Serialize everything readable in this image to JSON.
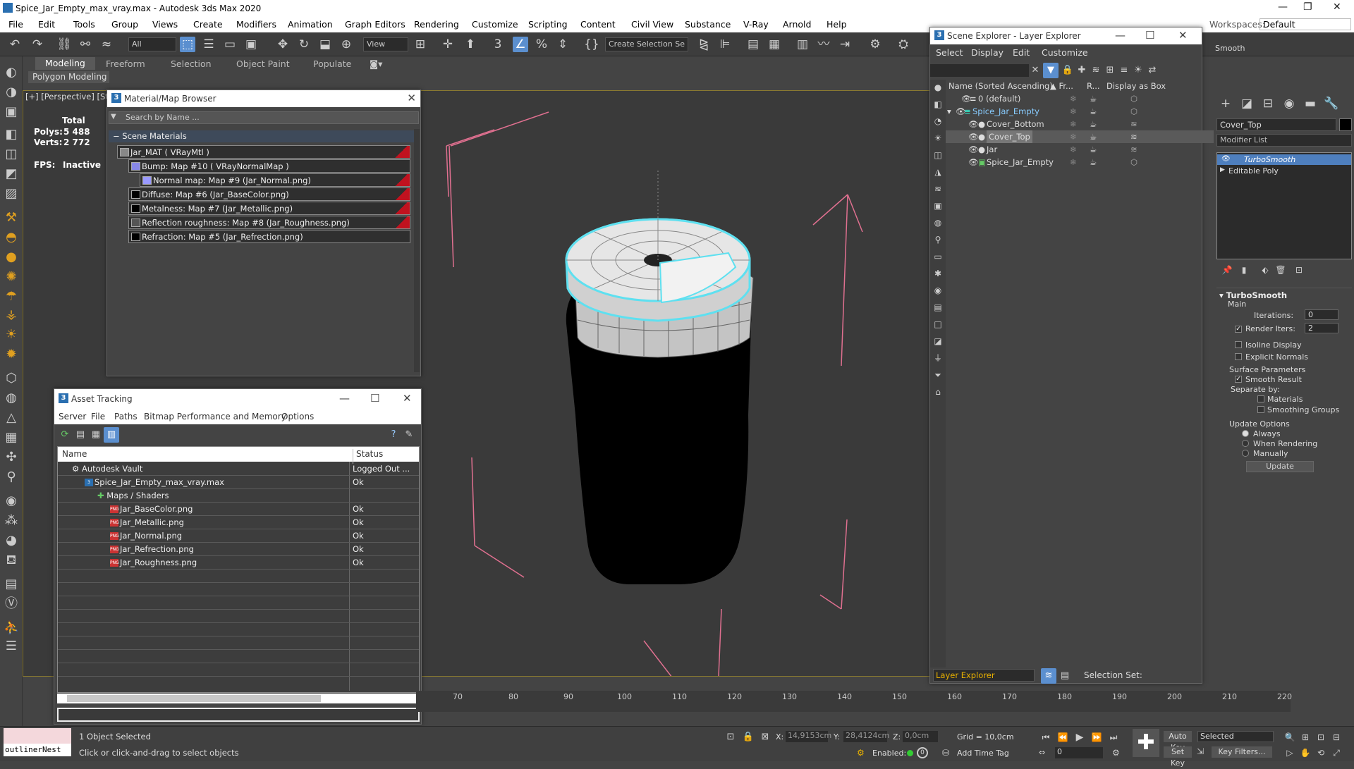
{
  "app": {
    "title": "Spice_Jar_Empty_max_vray.max - Autodesk 3ds Max 2020"
  },
  "menu": [
    "File",
    "Edit",
    "Tools",
    "Group",
    "Views",
    "Create",
    "Modifiers",
    "Animation",
    "Graph Editors",
    "Rendering",
    "Customize",
    "Scripting",
    "Content",
    "Civil View",
    "Substance",
    "V-Ray",
    "Arnold",
    "Help"
  ],
  "workspaces": {
    "label": "Workspaces:",
    "value": "Default"
  },
  "toolbar": {
    "filter": "All",
    "view": "View",
    "selection_set": "Create Selection Se"
  },
  "ribbon": {
    "tabs": [
      "Modeling",
      "Freeform",
      "Selection",
      "Object Paint",
      "Populate"
    ],
    "sub": "Polygon Modeling"
  },
  "viewport": {
    "label": "[+] [Perspective] [St",
    "stats": {
      "total": "Total",
      "polys_label": "Polys:",
      "polys": "5 488",
      "verts_label": "Verts:",
      "verts": "2 772",
      "fps_label": "FPS:",
      "fps": "Inactive"
    }
  },
  "material_browser": {
    "title": "Material/Map Browser",
    "search": "Search by Name ...",
    "section": "Scene Materials",
    "items": [
      "Jar_MAT  ( VRayMtl )",
      "Bump: Map #10  ( VRayNormalMap )",
      "Normal map: Map #9 (Jar_Normal.png)",
      "Diffuse: Map #6 (Jar_BaseColor.png)",
      "Metalness: Map #7 (Jar_Metallic.png)",
      "Reflection roughness: Map #8 (Jar_Roughness.png)",
      "Refraction: Map #5 (Jar_Refrection.png)"
    ]
  },
  "asset_tracking": {
    "title": "Asset Tracking",
    "menu": [
      "Server",
      "File",
      "Paths",
      "Bitmap Performance and Memory",
      "Options"
    ],
    "columns": [
      "Name",
      "Status"
    ],
    "rows": [
      {
        "name": "Autodesk Vault",
        "status": "Logged Out ..."
      },
      {
        "name": "Spice_Jar_Empty_max_vray.max",
        "status": "Ok"
      },
      {
        "name": "Maps / Shaders",
        "status": ""
      },
      {
        "name": "Jar_BaseColor.png",
        "status": "Ok"
      },
      {
        "name": "Jar_Metallic.png",
        "status": "Ok"
      },
      {
        "name": "Jar_Normal.png",
        "status": "Ok"
      },
      {
        "name": "Jar_Refrection.png",
        "status": "Ok"
      },
      {
        "name": "Jar_Roughness.png",
        "status": "Ok"
      }
    ]
  },
  "scene_explorer": {
    "title": "Scene Explorer - Layer Explorer",
    "menu": [
      "Select",
      "Display",
      "Edit",
      "Customize"
    ],
    "columns": [
      "Name (Sorted Ascending)",
      "▲ Fr...",
      "R...",
      "Display as Box"
    ],
    "rows": [
      {
        "name": "0 (default)"
      },
      {
        "name": "Spice_Jar_Empty"
      },
      {
        "name": "Cover_Bottom"
      },
      {
        "name": "Cover_Top"
      },
      {
        "name": "Jar"
      },
      {
        "name": "Spice_Jar_Empty"
      }
    ],
    "footer_dropdown": "Layer Explorer",
    "footer_label": "Selection Set:"
  },
  "command_panel": {
    "object_name": "Cover_Top",
    "modifier_list": "Modifier List",
    "stack": [
      "TurboSmooth",
      "Editable Poly"
    ],
    "rollout": "TurboSmooth",
    "main": "Main",
    "iterations_label": "Iterations:",
    "iterations": "0",
    "render_iters_label": "Render Iters:",
    "render_iters": "2",
    "isoline": "Isoline Display",
    "explicit": "Explicit Normals",
    "surface": "Surface Parameters",
    "smooth": "Smooth Result",
    "separate": "Separate by:",
    "materials": "Materials",
    "smoothing": "Smoothing Groups",
    "update_opts": "Update Options",
    "always": "Always",
    "when_render": "When Rendering",
    "manually": "Manually",
    "update_btn": "Update"
  },
  "timeline": {
    "ticks": [
      "70",
      "80",
      "90",
      "100",
      "110",
      "120",
      "130",
      "140",
      "150",
      "160",
      "170",
      "180",
      "190",
      "200",
      "210",
      "220"
    ]
  },
  "status": {
    "script_input": "outlinerNest",
    "selected": "1 Object Selected",
    "hint": "Click or click-and-drag to select objects",
    "x_label": "X:",
    "x": "14,9153cm",
    "y_label": "Y:",
    "y": "28,4124cm",
    "z_label": "Z:",
    "z": "0,0cm",
    "grid": "Grid = 10,0cm",
    "enabled": "Enabled:",
    "add_time_tag": "Add Time Tag",
    "auto_key": "Auto Key",
    "set_key": "Set Key",
    "selected_dd": "Selected",
    "key_filters": "Key Filters...",
    "frame": "0",
    "smooth_right": "Smooth"
  }
}
